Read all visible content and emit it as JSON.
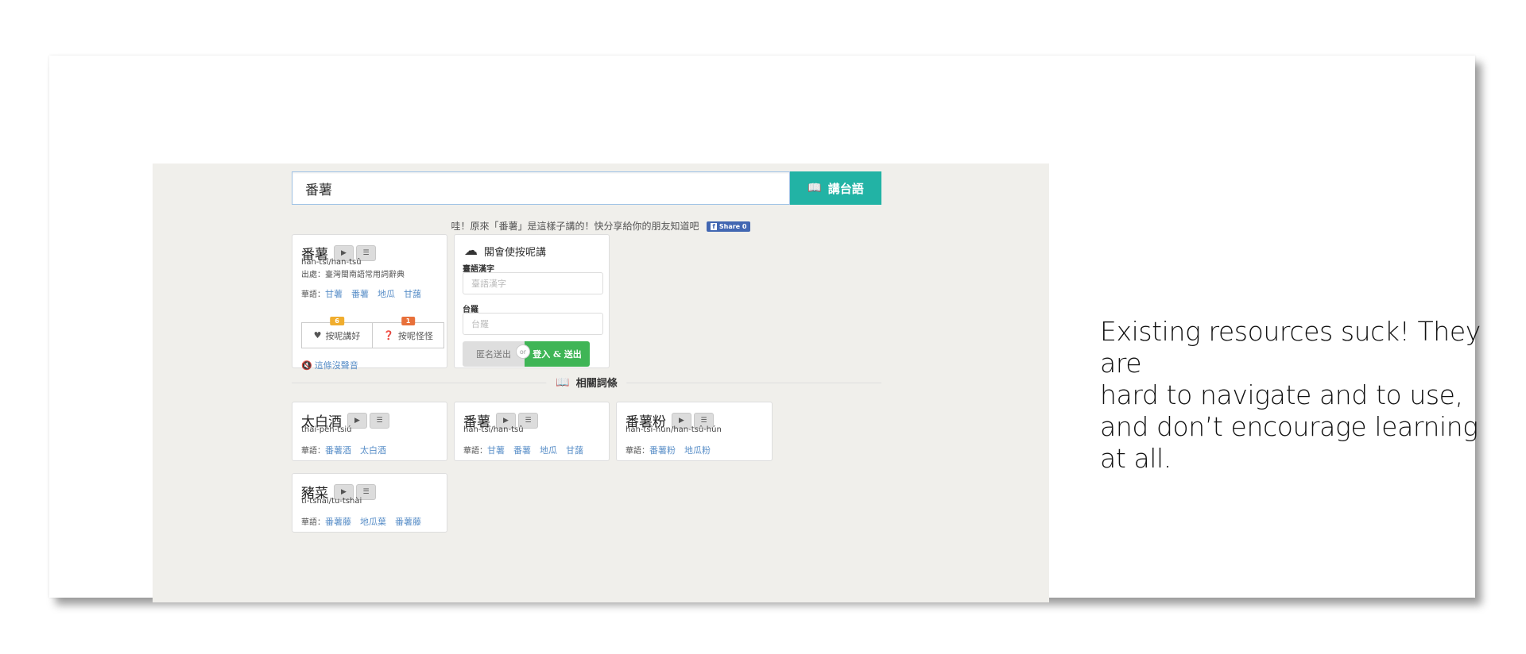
{
  "caption": {
    "lines": [
      "Existing resources suck! They are",
      "hard to navigate and to use,",
      "and don’t encourage learning",
      "at all."
    ]
  },
  "search": {
    "value": "番薯",
    "button_label": "講台語"
  },
  "share": {
    "text": "哇！原來「番薯」是這樣子講的！快分享給你的朋友知道吧",
    "fb_label": "Share 0"
  },
  "main_entry": {
    "word": "番薯",
    "romanization": "han-tsî/han-tsû",
    "source": "出處：臺灣閩南語常用詞辭典",
    "synonyms_label": "華語：",
    "synonyms": [
      "甘薯",
      "番薯",
      "地瓜",
      "甘藷"
    ],
    "vote_good": {
      "label": "按呢講好",
      "count": "6",
      "color": "#f0ad2e"
    },
    "vote_weird": {
      "label": "按呢怪怪",
      "count": "1",
      "color": "#e8703a"
    },
    "no_audio": "這條沒聲音"
  },
  "contribute": {
    "title": "閣會使按呢講",
    "hanji_label": "臺語漢字",
    "hanji_placeholder": "臺語漢字",
    "lomaji_label": "台羅",
    "lomaji_placeholder": "台羅",
    "anon_label": "匿名送出",
    "or_label": "or",
    "login_label": "登入 & 送出"
  },
  "related": {
    "heading": "相關詞條",
    "items": [
      {
        "word": "太白酒",
        "romanization": "thài-pe̍h-tsiú",
        "synonyms_label": "華語：",
        "synonyms": [
          "番薯酒",
          "太白酒"
        ]
      },
      {
        "word": "番薯",
        "romanization": "han-tsî/han-tsû",
        "synonyms_label": "華語：",
        "synonyms": [
          "甘薯",
          "番薯",
          "地瓜",
          "甘藷"
        ]
      },
      {
        "word": "番薯粉",
        "romanization": "han-tsî-hún/han-tsû-hún",
        "synonyms_label": "華語：",
        "synonyms": [
          "番薯粉",
          "地瓜粉"
        ]
      },
      {
        "word": "豬菜",
        "romanization": "ti-tshài/tu-tshài",
        "synonyms_label": "華語：",
        "synonyms": [
          "番薯藤",
          "地瓜葉",
          "番薯藤"
        ]
      }
    ]
  },
  "icons": {
    "play": "play-icon",
    "list": "list-icon"
  },
  "colors": {
    "accent": "#22b3a5",
    "link": "#5a8fc8",
    "login": "#3fb556",
    "page_bg": "#f0efeb"
  }
}
